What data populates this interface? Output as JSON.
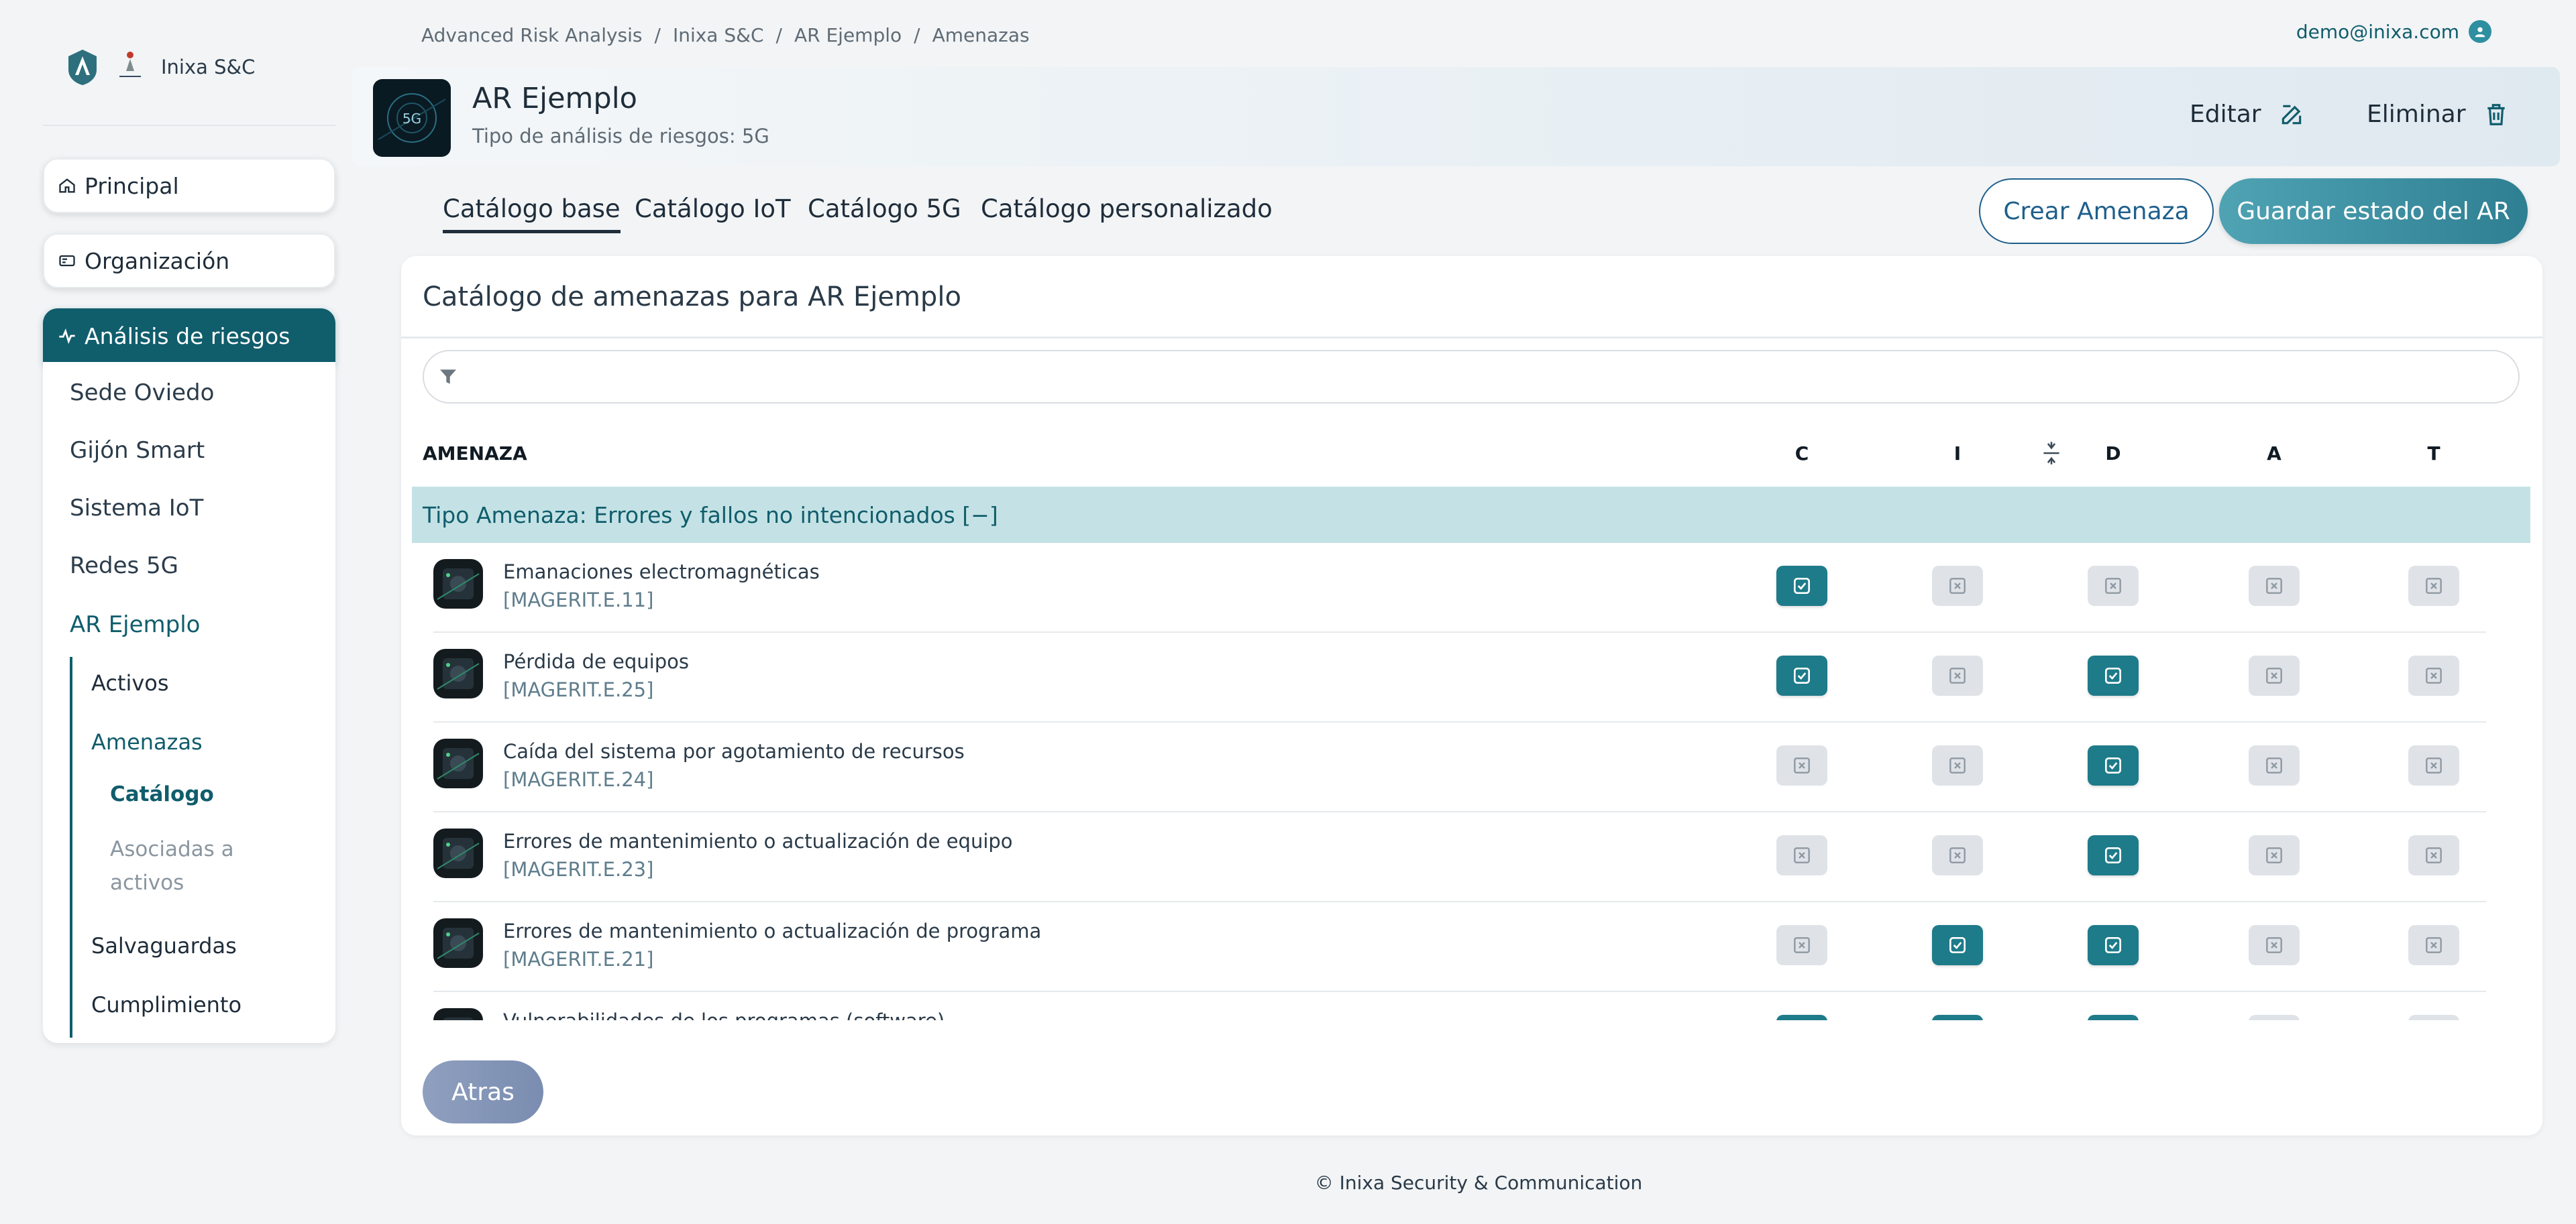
{
  "sidebar": {
    "company_name": "Inixa S&C",
    "nav": [
      {
        "label": "Principal",
        "icon": "home-icon"
      },
      {
        "label": "Organización",
        "icon": "id-card-icon"
      },
      {
        "label": "Análisis de riesgos",
        "icon": "activity-icon"
      }
    ],
    "analyses": [
      "Sede Oviedo",
      "Gijón Smart",
      "Sistema IoT",
      "Redes 5G",
      "AR Ejemplo"
    ],
    "sub_items": [
      "Activos",
      "Amenazas",
      "Salvaguardas",
      "Cumplimiento"
    ],
    "threat_sub_items": [
      "Catálogo",
      "Asociadas a",
      "activos"
    ]
  },
  "breadcrumb": [
    "Advanced Risk Analysis",
    "Inixa S&C",
    "AR Ejemplo",
    "Amenazas"
  ],
  "user": {
    "email": "demo@inixa.com"
  },
  "header": {
    "title": "AR Ejemplo",
    "subtitle": "Tipo de análisis de riesgos: 5G",
    "edit_label": "Editar",
    "delete_label": "Eliminar",
    "thumb_text": "5G"
  },
  "tabs": [
    "Catálogo base",
    "Catálogo IoT",
    "Catálogo 5G",
    "Catálogo personalizado"
  ],
  "actions": {
    "create": "Crear Amenaza",
    "save": "Guardar estado del AR",
    "back": "Atras"
  },
  "card": {
    "title": "Catálogo de amenazas para AR Ejemplo",
    "filter_placeholder": ""
  },
  "table": {
    "columns": [
      "AMENAZA",
      "C",
      "I",
      "D",
      "A",
      "T"
    ],
    "group_label": "Tipo Amenaza: Errores y fallos no intencionados [−]",
    "rows": [
      {
        "name": "Emanaciones electromagnéticas",
        "code": "[MAGERIT.E.11]",
        "flags": [
          true,
          false,
          false,
          false,
          false
        ]
      },
      {
        "name": "Pérdida de equipos",
        "code": "[MAGERIT.E.25]",
        "flags": [
          true,
          false,
          true,
          false,
          false
        ]
      },
      {
        "name": "Caída del sistema por agotamiento de recursos",
        "code": "[MAGERIT.E.24]",
        "flags": [
          false,
          false,
          true,
          false,
          false
        ]
      },
      {
        "name": "Errores de mantenimiento o actualización de equipo",
        "code": "[MAGERIT.E.23]",
        "flags": [
          false,
          false,
          true,
          false,
          false
        ]
      },
      {
        "name": "Errores de mantenimiento o actualización de programa",
        "code": "[MAGERIT.E.21]",
        "flags": [
          false,
          true,
          true,
          false,
          false
        ]
      },
      {
        "name": "Vulnerabilidades de los programas (software)",
        "code": "",
        "flags": [
          true,
          true,
          true,
          false,
          false
        ]
      }
    ]
  },
  "footer": "© Inixa Security & Communication",
  "colors": {
    "primary": "#105d6c",
    "checked": "#1e7b8a",
    "group_bg": "#c4e2e5",
    "unchecked": "#dfe3e7"
  }
}
